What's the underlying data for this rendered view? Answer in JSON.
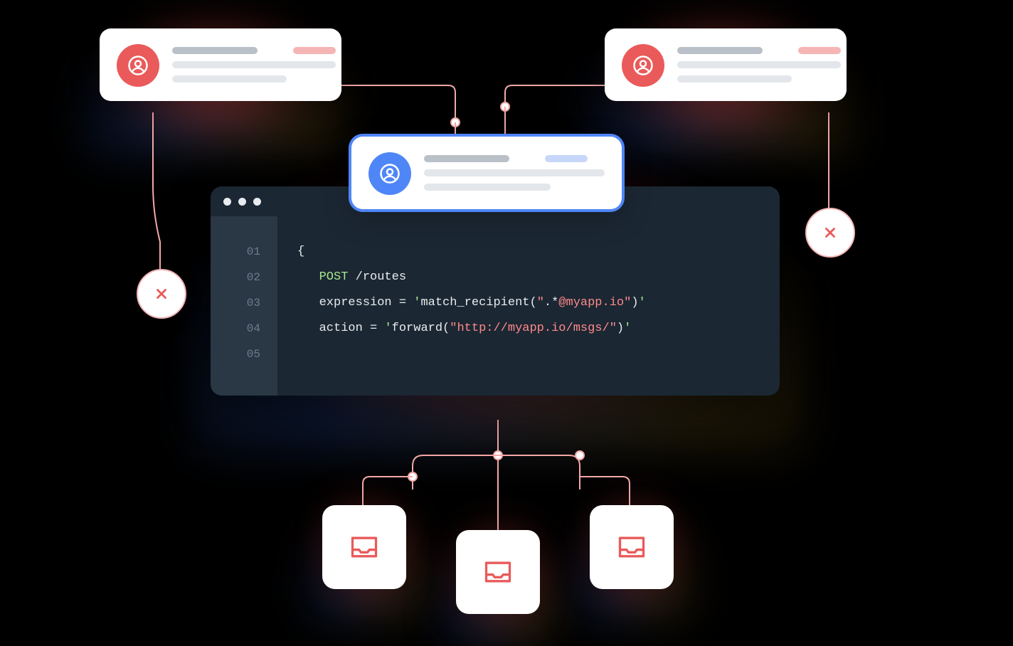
{
  "colors": {
    "accent_red": "#ea5a5a",
    "accent_blue": "#4f86f7",
    "glow_red": "#ff5050",
    "connector": "#f3a8a8",
    "code_bg": "#1b2733",
    "gutter_bg": "#2a3744"
  },
  "messages": {
    "top_left": {
      "avatar_color": "red",
      "status": "rejected"
    },
    "top_right": {
      "avatar_color": "red",
      "status": "rejected"
    },
    "center": {
      "avatar_color": "blue",
      "status": "matched"
    }
  },
  "reject_icon_name": "close-icon",
  "inbox_icon_name": "inbox-icon",
  "code": {
    "line_numbers": [
      "01",
      "02",
      "03",
      "04",
      "05"
    ],
    "lines": {
      "l1": "{",
      "l2": {
        "method": "POST",
        "path": " /routes"
      },
      "l3": {
        "key": "expression",
        "eq": " = ",
        "q1": "'",
        "fn": "match_recipient(",
        "qq1": "\"",
        "regex_open": ".*",
        "str": "@myapp.io",
        "qq2": "\"",
        "close": ")",
        "q2": "'"
      },
      "l4": {
        "key": "action",
        "eq": " = ",
        "q1": "'",
        "fn": "forward(",
        "qq1": "\"",
        "url": "http://myapp.io/msgs/",
        "qq2": "\"",
        "close": ")",
        "q2": "'"
      },
      "l5": ""
    }
  }
}
